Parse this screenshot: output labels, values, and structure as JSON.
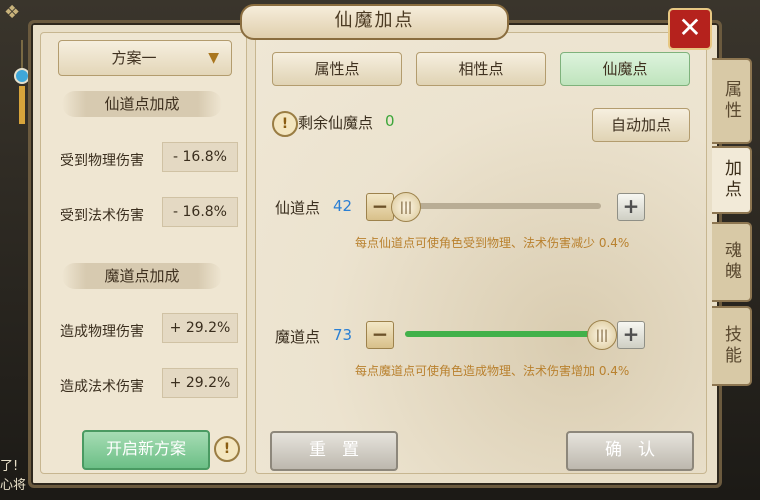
{
  "window": {
    "title": "仙魔加点",
    "close_icon": "✕"
  },
  "chat_lines": [
    "了!",
    "心将"
  ],
  "side_tabs": [
    {
      "label": "属性",
      "active": false
    },
    {
      "label": "加点",
      "active": true
    },
    {
      "label": "魂魄",
      "active": false
    },
    {
      "label": "技能",
      "active": false
    }
  ],
  "plan": {
    "selected": "方案一"
  },
  "xian_section": {
    "title": "仙道点加成",
    "stats": [
      {
        "label": "受到物理伤害",
        "value": "- 16.8%"
      },
      {
        "label": "受到法术伤害",
        "value": "- 16.8%"
      }
    ]
  },
  "mo_section": {
    "title": "魔道点加成",
    "stats": [
      {
        "label": "造成物理伤害",
        "value": "+ 29.2%"
      },
      {
        "label": "造成法术伤害",
        "value": "+ 29.2%"
      }
    ]
  },
  "buttons": {
    "new_plan": "开启新方案",
    "auto_assign": "自动加点",
    "reset": "重置",
    "confirm": "确认"
  },
  "tabs": [
    {
      "label": "属性点",
      "active": false
    },
    {
      "label": "相性点",
      "active": false
    },
    {
      "label": "仙魔点",
      "active": true
    }
  ],
  "remaining": {
    "label": "剩余仙魔点",
    "value": "0"
  },
  "sliders": {
    "xian": {
      "label": "仙道点",
      "value": "42",
      "level": 0.0,
      "hint": "每点仙道点可使角色受到物理、法术伤害减少 0.4%"
    },
    "mo": {
      "label": "魔道点",
      "value": "73",
      "level": 1.0,
      "hint": "每点魔道点可使角色造成物理、法术伤害增加 0.4%"
    }
  },
  "colors": {
    "accent_green": "#42b14a",
    "value_blue": "#2a7fd4",
    "close_red": "#b5221d"
  }
}
